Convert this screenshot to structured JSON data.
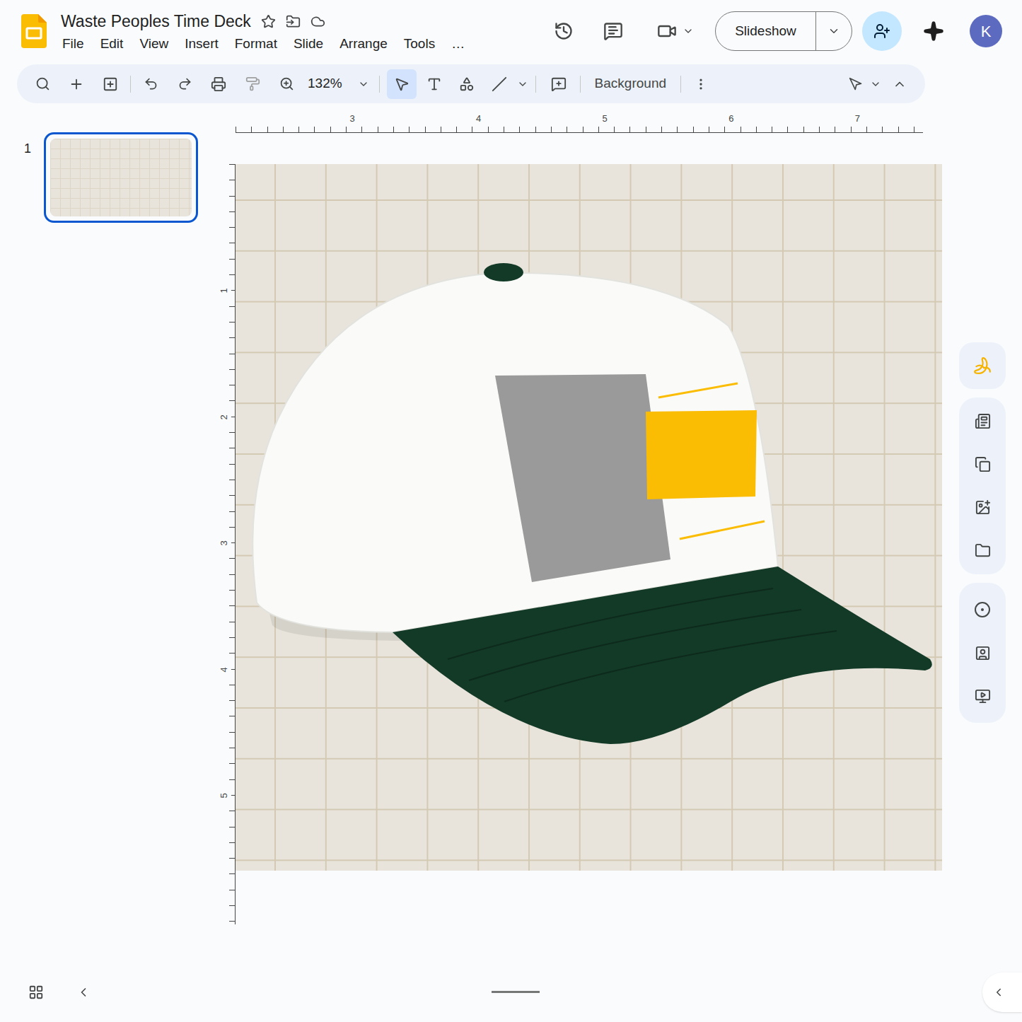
{
  "app": {
    "title": "Waste Peoples Time Deck",
    "menus": [
      "File",
      "Edit",
      "View",
      "Insert",
      "Format",
      "Slide",
      "Arrange",
      "Tools",
      "…"
    ],
    "slideshow": "Slideshow",
    "avatar": "K"
  },
  "toolbar": {
    "zoom": "132%",
    "background": "Background",
    "tools": [
      {
        "kind": "select",
        "selected": true
      },
      {
        "kind": "text",
        "selected": false
      },
      {
        "kind": "shape",
        "selected": false
      },
      {
        "kind": "line",
        "selected": false
      }
    ]
  },
  "ruler": {
    "top": [
      "3",
      "4",
      "5",
      "6",
      "7"
    ],
    "left": [
      "1",
      "2",
      "3",
      "4",
      "5"
    ]
  },
  "slides": [
    {
      "number": "1",
      "selected": true
    }
  ]
}
